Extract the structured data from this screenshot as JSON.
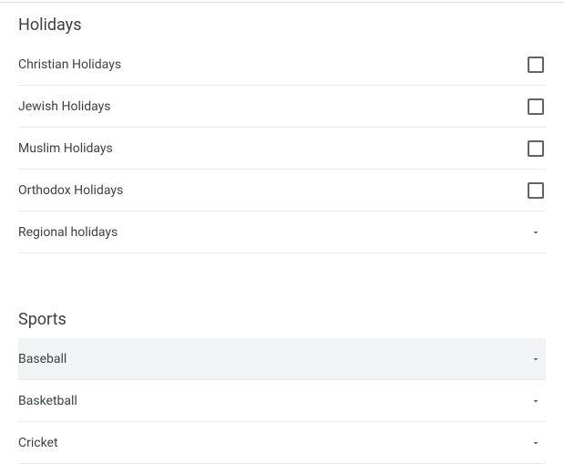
{
  "sections": {
    "holidays": {
      "title": "Holidays",
      "items": [
        {
          "label": "Christian Holidays"
        },
        {
          "label": "Jewish Holidays"
        },
        {
          "label": "Muslim Holidays"
        },
        {
          "label": "Orthodox Holidays"
        },
        {
          "label": "Regional holidays"
        }
      ]
    },
    "sports": {
      "title": "Sports",
      "items": [
        {
          "label": "Baseball"
        },
        {
          "label": "Basketball"
        },
        {
          "label": "Cricket"
        }
      ]
    }
  }
}
